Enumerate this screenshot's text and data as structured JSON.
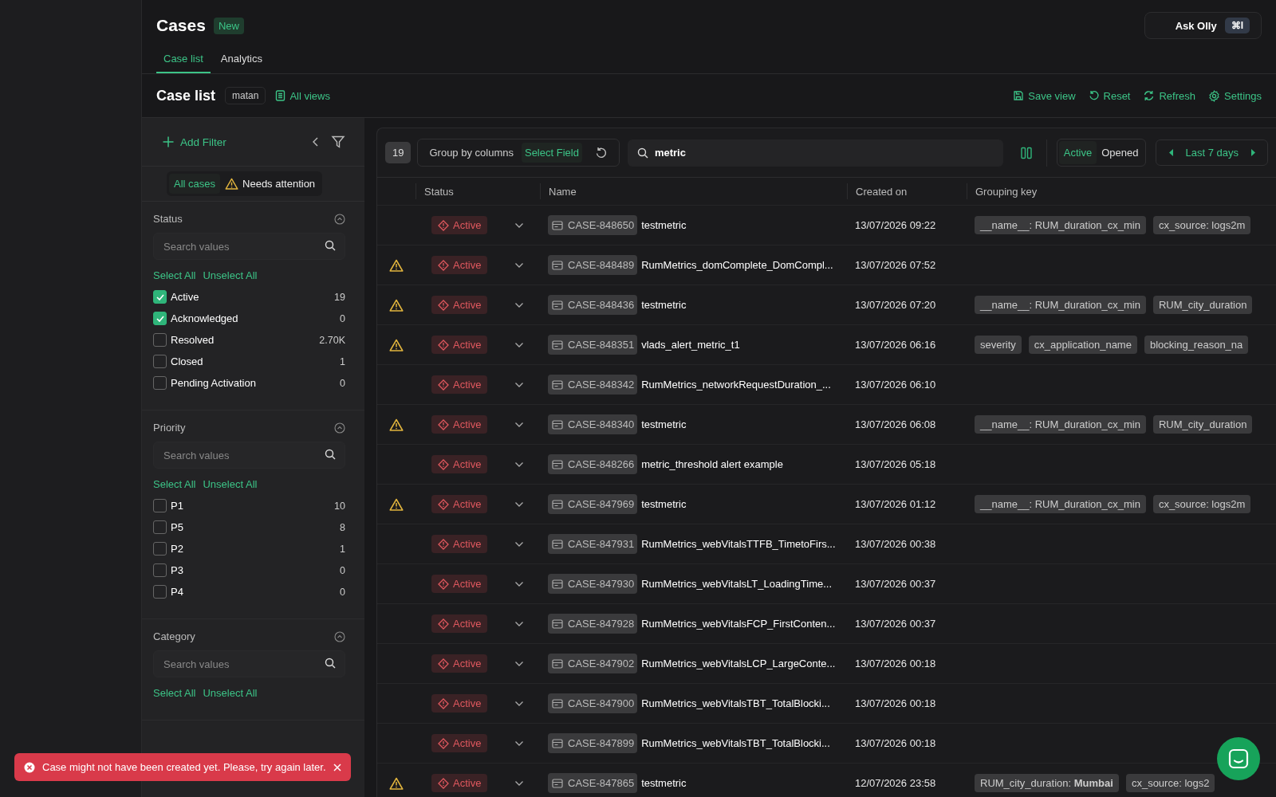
{
  "header": {
    "title": "Cases",
    "badge": "New",
    "assistant": {
      "label": "Ask Olly",
      "shortcut": "⌘I"
    }
  },
  "tabs": [
    {
      "label": "Case list",
      "selected": true
    },
    {
      "label": "Analytics",
      "selected": false
    }
  ],
  "view_bar": {
    "title": "Case list",
    "view_name": "matan",
    "all_views": "All views",
    "actions": [
      {
        "kind": "save",
        "label": "Save view"
      },
      {
        "kind": "reset",
        "label": "Reset"
      },
      {
        "kind": "refresh",
        "label": "Refresh"
      },
      {
        "kind": "settings",
        "label": "Settings"
      }
    ]
  },
  "filters": {
    "add_filter": "Add Filter",
    "scope": [
      {
        "label": "All cases",
        "warning": false,
        "selected": true
      },
      {
        "label": "Needs attention",
        "warning": true,
        "selected": false
      }
    ],
    "groups": [
      {
        "title": "Status",
        "placeholder": "Search values",
        "select_all": "Select All",
        "unselect_all": "Unselect All",
        "options": [
          {
            "label": "Active",
            "count": "19",
            "checked": true
          },
          {
            "label": "Acknowledged",
            "count": "0",
            "checked": true
          },
          {
            "label": "Resolved",
            "count": "2.70K",
            "checked": false
          },
          {
            "label": "Closed",
            "count": "1",
            "checked": false
          },
          {
            "label": "Pending Activation",
            "count": "0",
            "checked": false
          }
        ]
      },
      {
        "title": "Priority",
        "placeholder": "Search values",
        "select_all": "Select All",
        "unselect_all": "Unselect All",
        "options": [
          {
            "label": "P1",
            "count": "10",
            "checked": false
          },
          {
            "label": "P5",
            "count": "8",
            "checked": false
          },
          {
            "label": "P2",
            "count": "1",
            "checked": false
          },
          {
            "label": "P3",
            "count": "0",
            "checked": false
          },
          {
            "label": "P4",
            "count": "0",
            "checked": false
          }
        ]
      },
      {
        "title": "Category",
        "placeholder": "Search values",
        "select_all": "Select All",
        "unselect_all": "Unselect All"
      }
    ]
  },
  "toolbar": {
    "count": "19",
    "group_by": "Group by columns",
    "select_field": "Select Field",
    "search_value": "metric",
    "state_toggle": [
      {
        "label": "Active",
        "selected": true
      },
      {
        "label": "Opened",
        "selected": false
      }
    ],
    "range": "Last 7 days"
  },
  "table": {
    "columns": [
      "Status",
      "Name",
      "Created on",
      "Grouping key"
    ],
    "rows": [
      {
        "warning": false,
        "status": "Active",
        "case_id": "CASE-848650",
        "name": "testmetric",
        "created": "13/07/2026 09:22",
        "tags": [
          "__name__: RUM_duration_cx_min",
          "cx_source: logs2m"
        ]
      },
      {
        "warning": true,
        "status": "Active",
        "case_id": "CASE-848489",
        "name": "RumMetrics_domComplete_DomCompl...",
        "created": "13/07/2026 07:52",
        "tags": []
      },
      {
        "warning": true,
        "status": "Active",
        "case_id": "CASE-848436",
        "name": "testmetric",
        "created": "13/07/2026 07:20",
        "tags": [
          "__name__: RUM_duration_cx_min",
          "RUM_city_duration"
        ]
      },
      {
        "warning": true,
        "status": "Active",
        "case_id": "CASE-848351",
        "name": "vlads_alert_metric_t1",
        "created": "13/07/2026 06:16",
        "tags": [
          "severity",
          "cx_application_name",
          "blocking_reason_na"
        ]
      },
      {
        "warning": false,
        "status": "Active",
        "case_id": "CASE-848342",
        "name": "RumMetrics_networkRequestDuration_...",
        "created": "13/07/2026 06:10",
        "tags": []
      },
      {
        "warning": true,
        "status": "Active",
        "case_id": "CASE-848340",
        "name": "testmetric",
        "created": "13/07/2026 06:08",
        "tags": [
          "__name__: RUM_duration_cx_min",
          "RUM_city_duration"
        ]
      },
      {
        "warning": false,
        "status": "Active",
        "case_id": "CASE-848266",
        "name": "metric_threshold alert example",
        "created": "13/07/2026 05:18",
        "tags": []
      },
      {
        "warning": true,
        "status": "Active",
        "case_id": "CASE-847969",
        "name": "testmetric",
        "created": "13/07/2026 01:12",
        "tags": [
          "__name__: RUM_duration_cx_min",
          "cx_source: logs2m"
        ]
      },
      {
        "warning": false,
        "status": "Active",
        "case_id": "CASE-847931",
        "name": "RumMetrics_webVitalsTTFB_TimetoFirs...",
        "created": "13/07/2026 00:38",
        "tags": []
      },
      {
        "warning": false,
        "status": "Active",
        "case_id": "CASE-847930",
        "name": "RumMetrics_webVitalsLT_LoadingTime...",
        "created": "13/07/2026 00:37",
        "tags": []
      },
      {
        "warning": false,
        "status": "Active",
        "case_id": "CASE-847928",
        "name": "RumMetrics_webVitalsFCP_FirstConten...",
        "created": "13/07/2026 00:37",
        "tags": []
      },
      {
        "warning": false,
        "status": "Active",
        "case_id": "CASE-847902",
        "name": "RumMetrics_webVitalsLCP_LargeConte...",
        "created": "13/07/2026 00:18",
        "tags": []
      },
      {
        "warning": false,
        "status": "Active",
        "case_id": "CASE-847900",
        "name": "RumMetrics_webVitalsTBT_TotalBlocki...",
        "created": "13/07/2026 00:18",
        "tags": []
      },
      {
        "warning": false,
        "status": "Active",
        "case_id": "CASE-847899",
        "name": "RumMetrics_webVitalsTBT_TotalBlocki...",
        "created": "13/07/2026 00:18",
        "tags": []
      },
      {
        "warning": true,
        "status": "Active",
        "case_id": "CASE-847865",
        "name": "testmetric",
        "created": "12/07/2026 23:58",
        "tags": [
          "RUM_city_duration: **Mumbai**",
          "cx_source: logs2"
        ]
      }
    ]
  },
  "toast": {
    "message": "Case might not have been created yet. Please, try again later."
  }
}
